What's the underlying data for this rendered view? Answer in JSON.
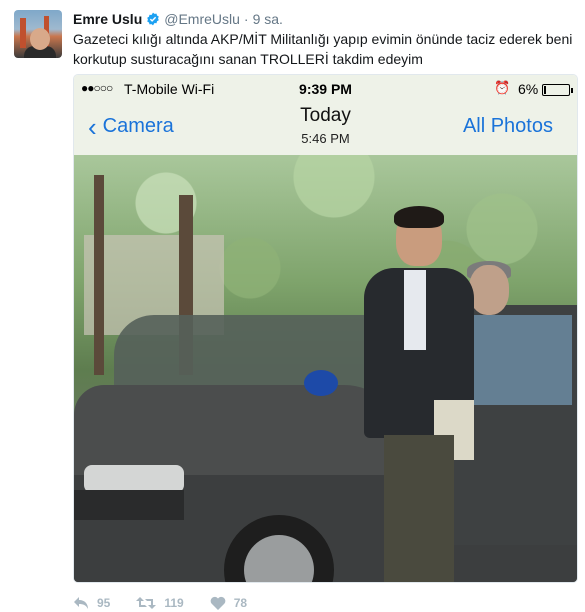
{
  "tweet": {
    "author_name": "Emre Uslu",
    "handle": "@EmreUslu",
    "separator": "·",
    "time": "9 sa.",
    "text": "Gazeteci kılığı altında AKP/MİT Militanlığı yapıp evimin önünde taciz ederek beni korkutup susturacağını sanan TROLLERİ takdim edeyim",
    "verified": true,
    "verified_color": "#1da1f2"
  },
  "screenshot": {
    "signal": "●●○○○",
    "carrier": "T-Mobile Wi-Fi",
    "time": "9:39 PM",
    "battery": "6%",
    "battery_level": 0.06,
    "back_label": "Camera",
    "title": "Today",
    "subtitle": "5:46 PM",
    "right_button": "All Photos",
    "accent": "#1a73d9"
  },
  "actions": {
    "reply_count": "95",
    "retweet_count": "119",
    "like_count": "78",
    "icon_color": "#aab8c2"
  }
}
